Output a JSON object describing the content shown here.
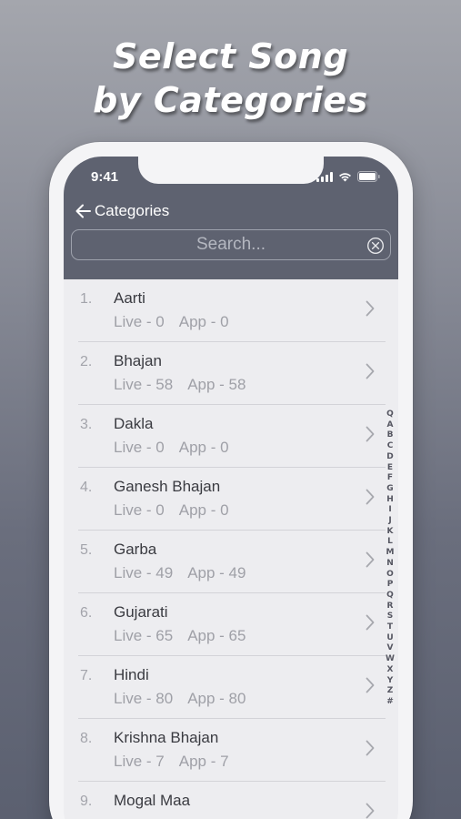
{
  "headline": {
    "line1": "Select Song",
    "line2": "by Categories"
  },
  "status_bar": {
    "time": "9:41"
  },
  "nav": {
    "back_label": "Categories"
  },
  "search": {
    "placeholder": "Search..."
  },
  "categories": [
    {
      "num": "1.",
      "name": "Aarti",
      "live": "Live - 0",
      "app": "App - 0"
    },
    {
      "num": "2.",
      "name": "Bhajan",
      "live": "Live - 58",
      "app": "App - 58"
    },
    {
      "num": "3.",
      "name": "Dakla",
      "live": "Live - 0",
      "app": "App - 0"
    },
    {
      "num": "4.",
      "name": "Ganesh Bhajan",
      "live": "Live - 0",
      "app": "App - 0"
    },
    {
      "num": "5.",
      "name": "Garba",
      "live": "Live - 49",
      "app": "App - 49"
    },
    {
      "num": "6.",
      "name": "Gujarati",
      "live": "Live - 65",
      "app": "App - 65"
    },
    {
      "num": "7.",
      "name": "Hindi",
      "live": "Live - 80",
      "app": "App - 80"
    },
    {
      "num": "8.",
      "name": "Krishna Bhajan",
      "live": "Live - 7",
      "app": "App - 7"
    },
    {
      "num": "9.",
      "name": "Mogal Maa",
      "live": "",
      "app": ""
    }
  ],
  "index_letters": [
    "Q",
    "A",
    "B",
    "C",
    "D",
    "E",
    "F",
    "G",
    "H",
    "I",
    "J",
    "K",
    "L",
    "M",
    "N",
    "O",
    "P",
    "Q",
    "R",
    "S",
    "T",
    "U",
    "V",
    "W",
    "X",
    "Y",
    "Z",
    "#"
  ],
  "colors": {
    "header_bg": "#5e6270",
    "list_bg": "#ededf0",
    "frame": "#f4f4f6"
  }
}
